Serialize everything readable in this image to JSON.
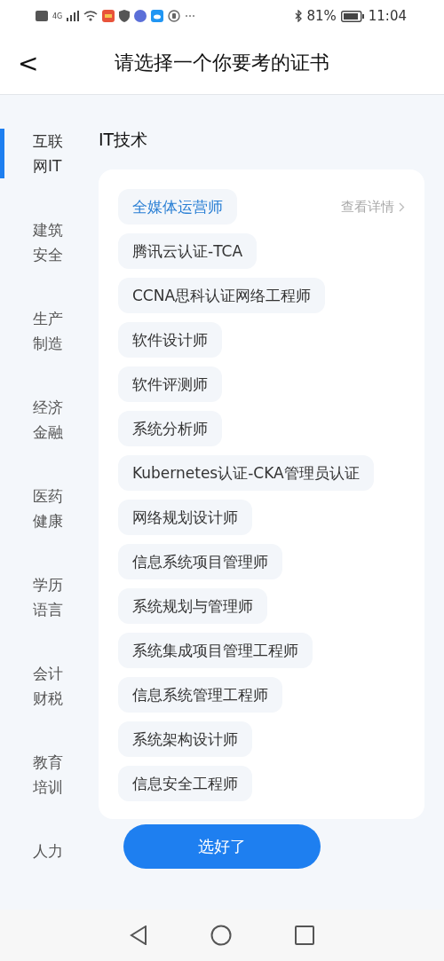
{
  "status_bar": {
    "battery": "81%",
    "time": "11:04",
    "network": "4G"
  },
  "header": {
    "back": "<",
    "title": "请选择一个你要考的证书"
  },
  "sidebar": {
    "items": [
      {
        "label": "互联网IT",
        "selected": true
      },
      {
        "label": "建筑安全",
        "selected": false
      },
      {
        "label": "生产制造",
        "selected": false
      },
      {
        "label": "经济金融",
        "selected": false
      },
      {
        "label": "医药健康",
        "selected": false
      },
      {
        "label": "学历语言",
        "selected": false
      },
      {
        "label": "会计财税",
        "selected": false
      },
      {
        "label": "教育培训",
        "selected": false
      },
      {
        "label": "人力",
        "selected": false
      }
    ]
  },
  "section": {
    "title": "IT技术",
    "details_link": "查看详情",
    "items": [
      {
        "label": "全媒体运营师",
        "selected": true
      },
      {
        "label": "腾讯云认证-TCA",
        "selected": false
      },
      {
        "label": "CCNA思科认证网络工程师",
        "selected": false
      },
      {
        "label": "软件设计师",
        "selected": false
      },
      {
        "label": "软件评测师",
        "selected": false
      },
      {
        "label": "系统分析师",
        "selected": false
      },
      {
        "label": "Kubernetes认证-CKA管理员认证",
        "selected": false
      },
      {
        "label": "网络规划设计师",
        "selected": false
      },
      {
        "label": "信息系统项目管理师",
        "selected": false
      },
      {
        "label": "系统规划与管理师",
        "selected": false
      },
      {
        "label": "系统集成项目管理工程师",
        "selected": false
      },
      {
        "label": "信息系统管理工程师",
        "selected": false
      },
      {
        "label": "系统架构设计师",
        "selected": false
      },
      {
        "label": "信息安全工程师",
        "selected": false
      }
    ]
  },
  "confirm_button": "选好了"
}
